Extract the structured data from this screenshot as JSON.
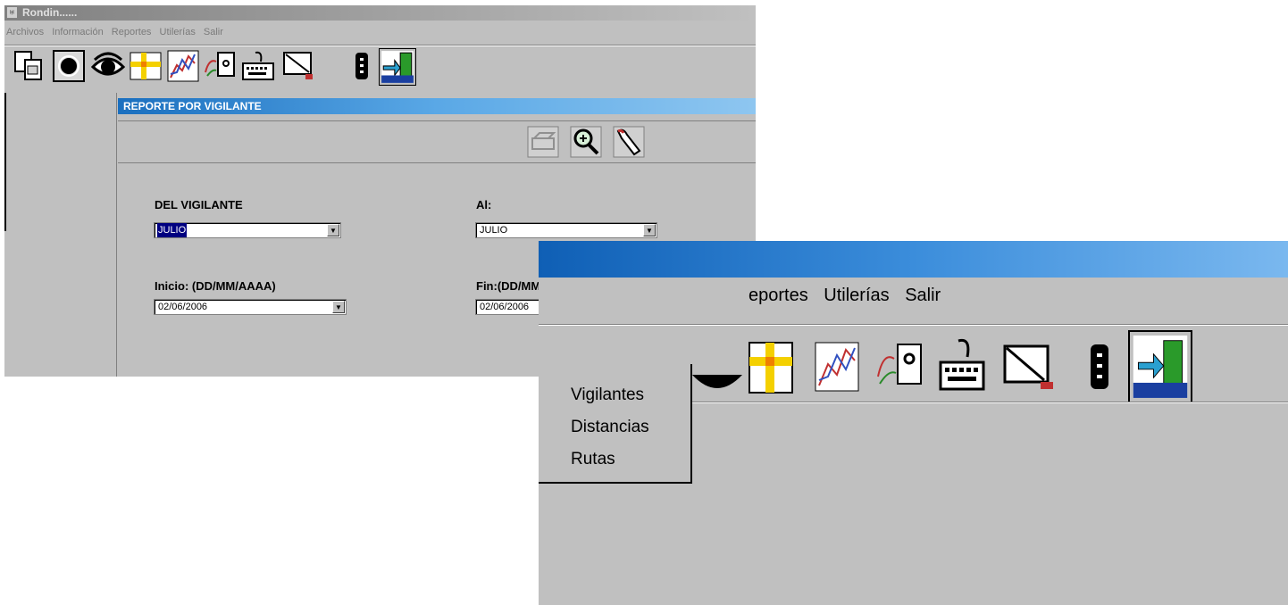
{
  "app": {
    "title": "Rondin......"
  },
  "menu": {
    "items": [
      "Archivos",
      "Información",
      "Reportes",
      "Utilerías",
      "Salir"
    ]
  },
  "toolbar": {
    "icons": [
      "file-copy-icon",
      "record-icon",
      "eye-icon",
      "grid-icon",
      "chart-icon",
      "route-icon",
      "keyboard-icon",
      "document-pen-icon",
      "battery-icon",
      "exit-door-icon"
    ]
  },
  "dialog": {
    "title": "REPORTE POR VIGILANTE",
    "toolbar_icons": [
      "print-icon",
      "preview-icon",
      "pointer-icon"
    ],
    "from_guard_label": "DEL VIGILANTE",
    "from_guard_value": "JULIO",
    "to_guard_label": "Al:",
    "to_guard_value": "JULIO",
    "start_label": "Inicio: (DD/MM/AAAA)",
    "start_value": "02/06/2006",
    "end_label": "Fin:(DD/MM/AAAA)",
    "end_value": "02/06/2006"
  },
  "zoom": {
    "menu": [
      "eportes",
      "Utilerías",
      "Salir"
    ],
    "dropdown": [
      "Vigilantes",
      "Distancias",
      "Rutas"
    ]
  },
  "colors": {
    "dialog_title_bg": "#1a6fbf",
    "window_bg": "#c0c0c0",
    "selection": "#000080"
  }
}
